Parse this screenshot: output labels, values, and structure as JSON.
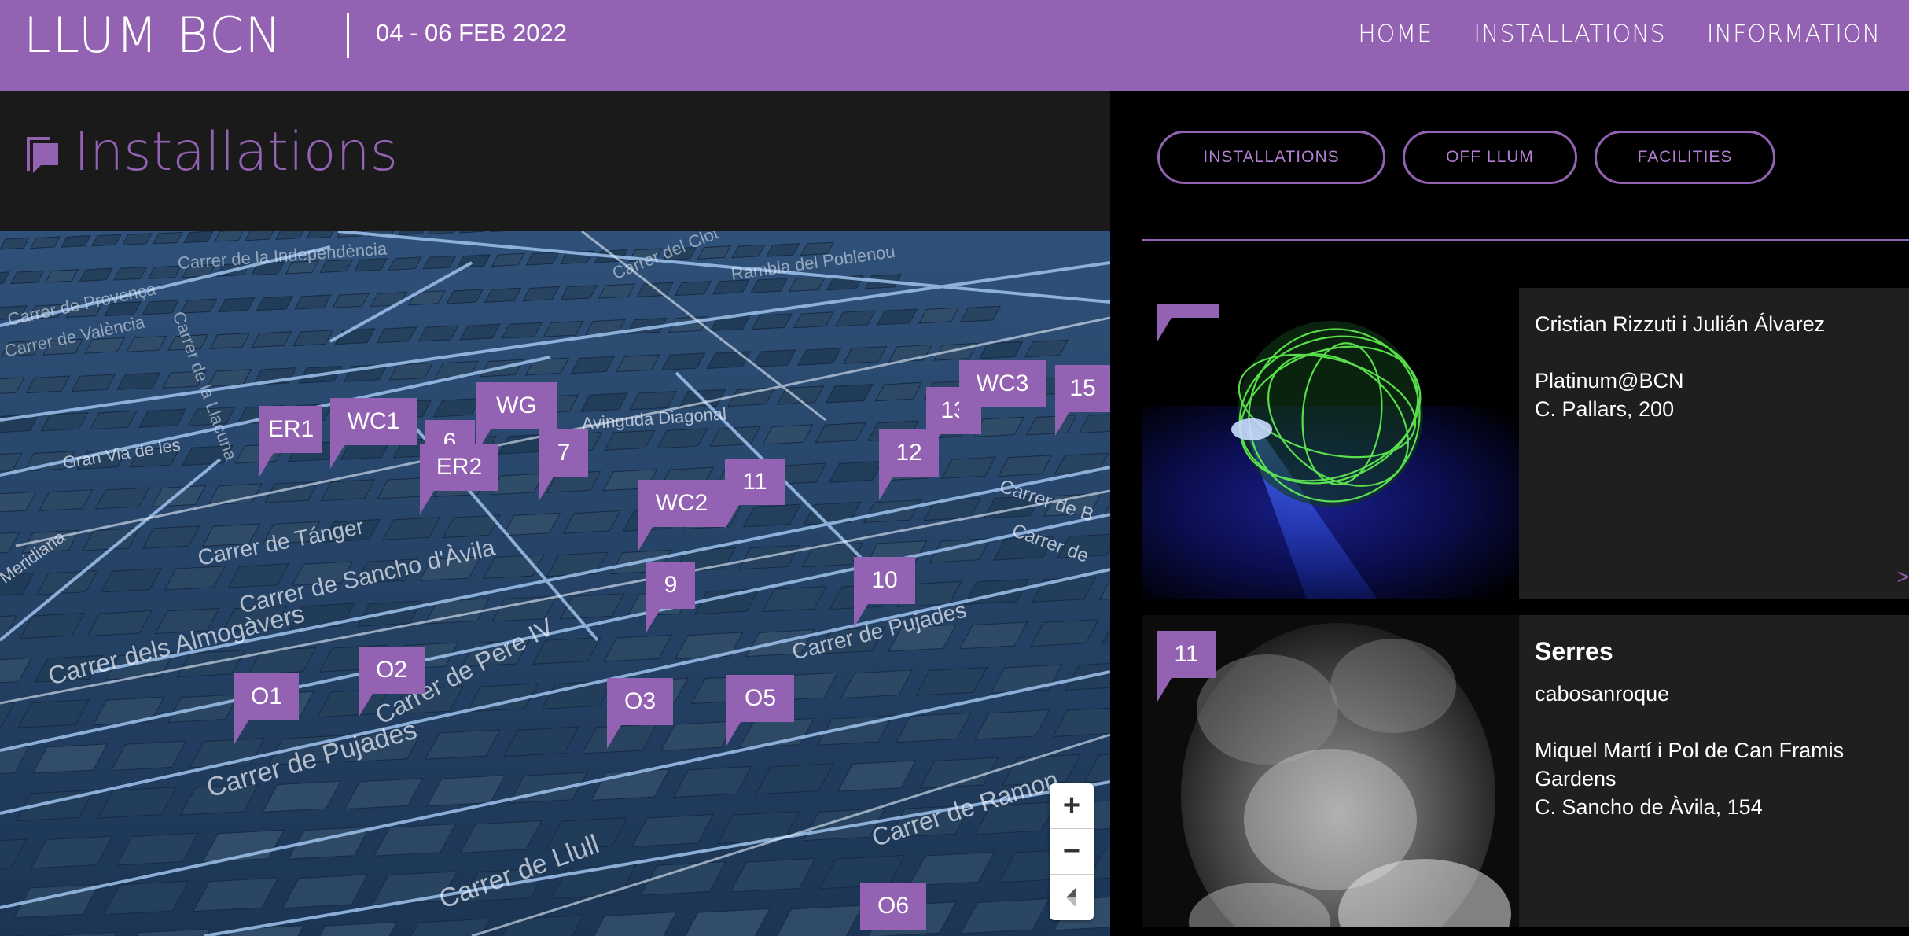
{
  "header": {
    "logo": "LLUM BCN",
    "dates": "04 - 06 FEB 2022",
    "nav": [
      "HOME",
      "INSTALLATIONS",
      "INFORMATION"
    ],
    "brand_color": "#9462b3"
  },
  "page": {
    "title": "Installations",
    "title_icon": "flag-icon"
  },
  "map": {
    "streets": [
      "Gran Via de les",
      "Avinguda Diagonal",
      "Carrer de Tánger",
      "Carrer de Sancho d'Àvila",
      "Carrer dels Almogàvers",
      "Carrer de Pere IV",
      "Carrer de Pujades",
      "Carrer de Pujades",
      "Carrer de Llull",
      "Carrer de Ramon",
      "Meridiana",
      "Carrer de Provença",
      "Carrer de València",
      "Carrer de B",
      "Carrer de",
      "Carrer de la Independència",
      "Rambla del Poblenou",
      "Carrer del Clot",
      "Carrer de la Llacuna"
    ],
    "markers": [
      "ER1",
      "WC1",
      "6",
      "ER2",
      "WG",
      "7",
      "11",
      "WC2",
      "9",
      "10",
      "12",
      "13",
      "WC3",
      "15",
      "O1",
      "O2",
      "O3",
      "O5",
      "O6"
    ],
    "controls": {
      "zoom_in": "+",
      "zoom_out": "−",
      "compass": "compass-icon"
    }
  },
  "filters": [
    "INSTALLATIONS",
    "OFF LLUM",
    "FACILITIES"
  ],
  "cards": [
    {
      "number": "",
      "title": "",
      "artist": "Cristian Rizzuti i Julián Álvarez",
      "venue": "Platinum@BCN",
      "address": "C. Pallars, 200",
      "arrow": ">"
    },
    {
      "number": "11",
      "title": "Serres",
      "artist": "cabosanroque",
      "venue": "Miquel Martí i Pol de Can Framis Gardens",
      "address": "C. Sancho de Àvila, 154",
      "arrow": ""
    }
  ]
}
